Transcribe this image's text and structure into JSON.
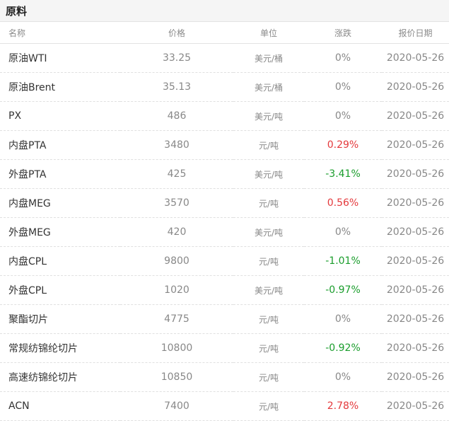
{
  "section_title": "原料",
  "columns": {
    "name": "名称",
    "price": "价格",
    "unit": "单位",
    "change": "涨跌",
    "date": "报价日期"
  },
  "rows": [
    {
      "name": "原油WTI",
      "price": "33.25",
      "unit": "美元/桶",
      "change": "0%",
      "trend": "flat",
      "date": "2020-05-26"
    },
    {
      "name": "原油Brent",
      "price": "35.13",
      "unit": "美元/桶",
      "change": "0%",
      "trend": "flat",
      "date": "2020-05-26"
    },
    {
      "name": "PX",
      "price": "486",
      "unit": "美元/吨",
      "change": "0%",
      "trend": "flat",
      "date": "2020-05-26"
    },
    {
      "name": "内盘PTA",
      "price": "3480",
      "unit": "元/吨",
      "change": "0.29%",
      "trend": "up",
      "date": "2020-05-26"
    },
    {
      "name": "外盘PTA",
      "price": "425",
      "unit": "美元/吨",
      "change": "-3.41%",
      "trend": "down",
      "date": "2020-05-26"
    },
    {
      "name": "内盘MEG",
      "price": "3570",
      "unit": "元/吨",
      "change": "0.56%",
      "trend": "up",
      "date": "2020-05-26"
    },
    {
      "name": "外盘MEG",
      "price": "420",
      "unit": "美元/吨",
      "change": "0%",
      "trend": "flat",
      "date": "2020-05-26"
    },
    {
      "name": "内盘CPL",
      "price": "9800",
      "unit": "元/吨",
      "change": "-1.01%",
      "trend": "down",
      "date": "2020-05-26"
    },
    {
      "name": "外盘CPL",
      "price": "1020",
      "unit": "美元/吨",
      "change": "-0.97%",
      "trend": "down",
      "date": "2020-05-26"
    },
    {
      "name": "聚酯切片",
      "price": "4775",
      "unit": "元/吨",
      "change": "0%",
      "trend": "flat",
      "date": "2020-05-26"
    },
    {
      "name": "常规纺锦纶切片",
      "price": "10800",
      "unit": "元/吨",
      "change": "-0.92%",
      "trend": "down",
      "date": "2020-05-26"
    },
    {
      "name": "高速纺锦纶切片",
      "price": "10850",
      "unit": "元/吨",
      "change": "0%",
      "trend": "flat",
      "date": "2020-05-26"
    },
    {
      "name": "ACN",
      "price": "7400",
      "unit": "元/吨",
      "change": "2.78%",
      "trend": "up",
      "date": "2020-05-26"
    }
  ],
  "colors": {
    "up": "#e4393c",
    "down": "#1a9d2c",
    "flat": "#888888"
  }
}
